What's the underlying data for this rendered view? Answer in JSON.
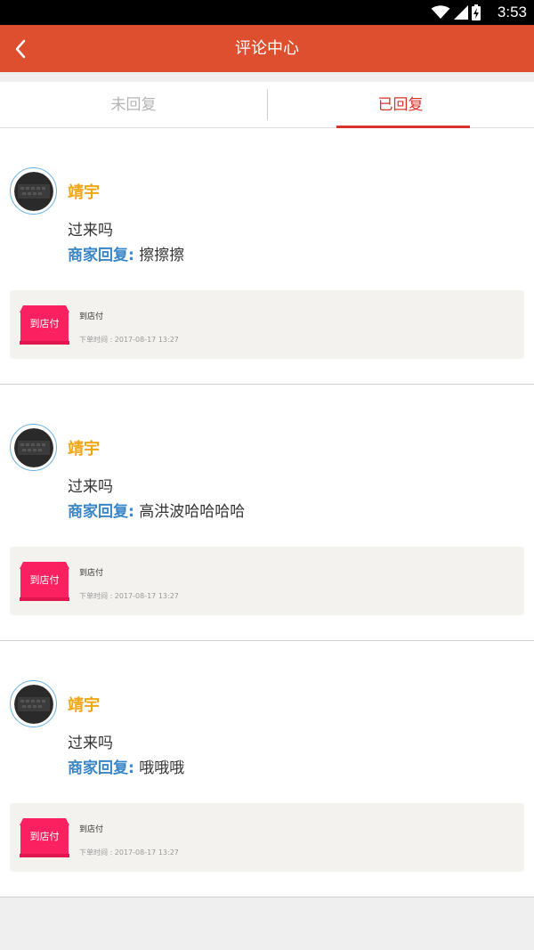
{
  "status_bar": {
    "time": "3:53",
    "icons": [
      "wifi-icon",
      "signal-icon",
      "battery-icon"
    ]
  },
  "nav": {
    "title": "评论中心",
    "back_icon": "chevron-left-icon"
  },
  "tabs": [
    {
      "label": "未回复",
      "active": false
    },
    {
      "label": "已回复",
      "active": true
    }
  ],
  "reply_label": "商家回复:",
  "comments": [
    {
      "username": "靖宇",
      "content": "过来吗",
      "reply": "擦擦擦",
      "order": {
        "badge": "到店付",
        "name": "到店付",
        "time": "下单时间 : 2017-08-17 13:27"
      }
    },
    {
      "username": "靖宇",
      "content": "过来吗",
      "reply": "高洪波哈哈哈哈",
      "order": {
        "badge": "到店付",
        "name": "到店付",
        "time": "下单时间 : 2017-08-17 13:27"
      }
    },
    {
      "username": "靖宇",
      "content": "过来吗",
      "reply": "哦哦哦",
      "order": {
        "badge": "到店付",
        "name": "到店付",
        "time": "下单时间 : 2017-08-17 13:27"
      }
    }
  ],
  "colors": {
    "nav": "#dd4f2e",
    "active_tab": "#d8332a",
    "username": "#f2a515",
    "reply_label": "#3a86c8",
    "store_badge": "#fb2160"
  }
}
